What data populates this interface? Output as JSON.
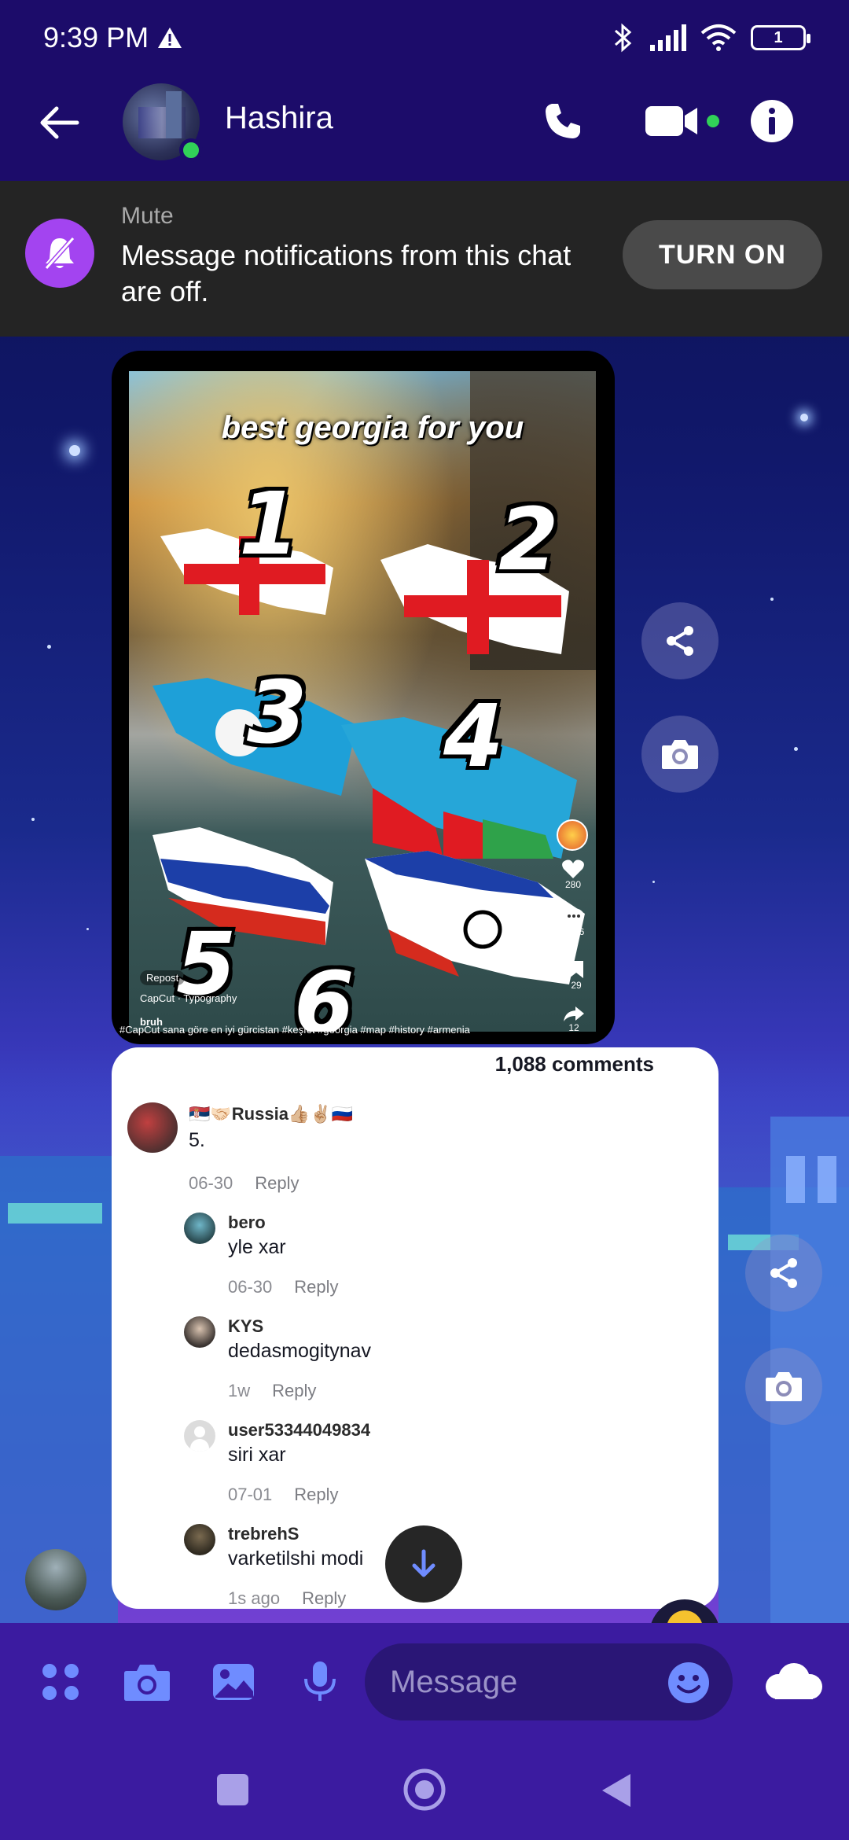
{
  "status_bar": {
    "time": "9:39 PM",
    "battery": "1"
  },
  "header": {
    "contact_name": "Hashira",
    "online": true
  },
  "mute_banner": {
    "title": "Mute",
    "message": "Message notifications from this chat are off.",
    "button_label": "TURN ON"
  },
  "video": {
    "overlay_title": "best georgia for you",
    "numbers": [
      "1",
      "2",
      "3",
      "4",
      "5",
      "6"
    ],
    "likes": "280",
    "comments": "1086",
    "saves": "29",
    "shares": "12",
    "repost_label": "Repost",
    "capcut_label": "CapCut · Typography",
    "username": "bruh",
    "hashtags": "#CapCut sana göre en iyi gürcistan #keşfet #georgia #map #history #armenia"
  },
  "comments_card": {
    "count_label": "1,088 comments",
    "reply_label": "Reply",
    "items": [
      {
        "user": "🇷🇸🤝🏻Russia👍🏼✌🏼🇷🇺",
        "text": "5.",
        "date": "06-30"
      },
      {
        "user": "bero",
        "text": "yle xar",
        "date": "06-30"
      },
      {
        "user": "KYS",
        "text": "dedasmogitynav",
        "date": "1w"
      },
      {
        "user": "user53344049834",
        "text": "siri xar",
        "date": "07-01"
      },
      {
        "user": "trebrehS",
        "text": "varketilshi modi",
        "date": "1s ago"
      }
    ]
  },
  "composer": {
    "placeholder": "Message"
  },
  "colors": {
    "header_bg": "#1c0c6a",
    "banner_bg": "#242424",
    "accent_purple": "#a344f0",
    "online_green": "#31d158",
    "composer_bg": "#3b1ba0"
  }
}
